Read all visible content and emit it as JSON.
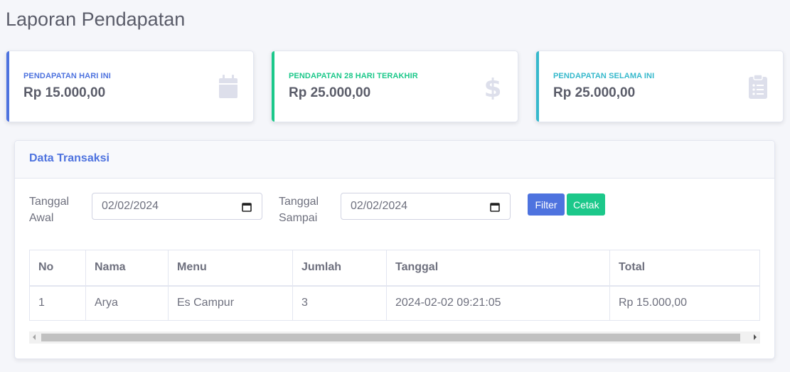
{
  "page": {
    "title": "Laporan Pendapatan"
  },
  "stats": [
    {
      "label": "PENDAPATAN HARI INI",
      "value": "Rp 15.000,00",
      "icon": "calendar-icon",
      "color": "#4e73df"
    },
    {
      "label": "PENDAPATAN 28 HARI TERAKHIR",
      "value": "Rp 25.000,00",
      "icon": "dollar-icon",
      "color": "#1cc88a"
    },
    {
      "label": "PENDAPATAN SELAMA INI",
      "value": "Rp 25.000,00",
      "icon": "clipboard-list-icon",
      "color": "#36b9cc"
    }
  ],
  "transactions": {
    "title": "Data Transaksi",
    "filters": {
      "start_label": "Tanggal\nAwal",
      "start_value": "02/02/2024",
      "end_label": "Tanggal\nSampai",
      "end_value": "02/02/2024",
      "filter_button": "Filter",
      "print_button": "Cetak"
    },
    "columns": [
      "No",
      "Nama",
      "Menu",
      "Jumlah",
      "Tanggal",
      "Total"
    ],
    "rows": [
      [
        "1",
        "Arya",
        "Es Campur",
        "3",
        "2024-02-02 09:21:05",
        "Rp 15.000,00"
      ]
    ]
  }
}
